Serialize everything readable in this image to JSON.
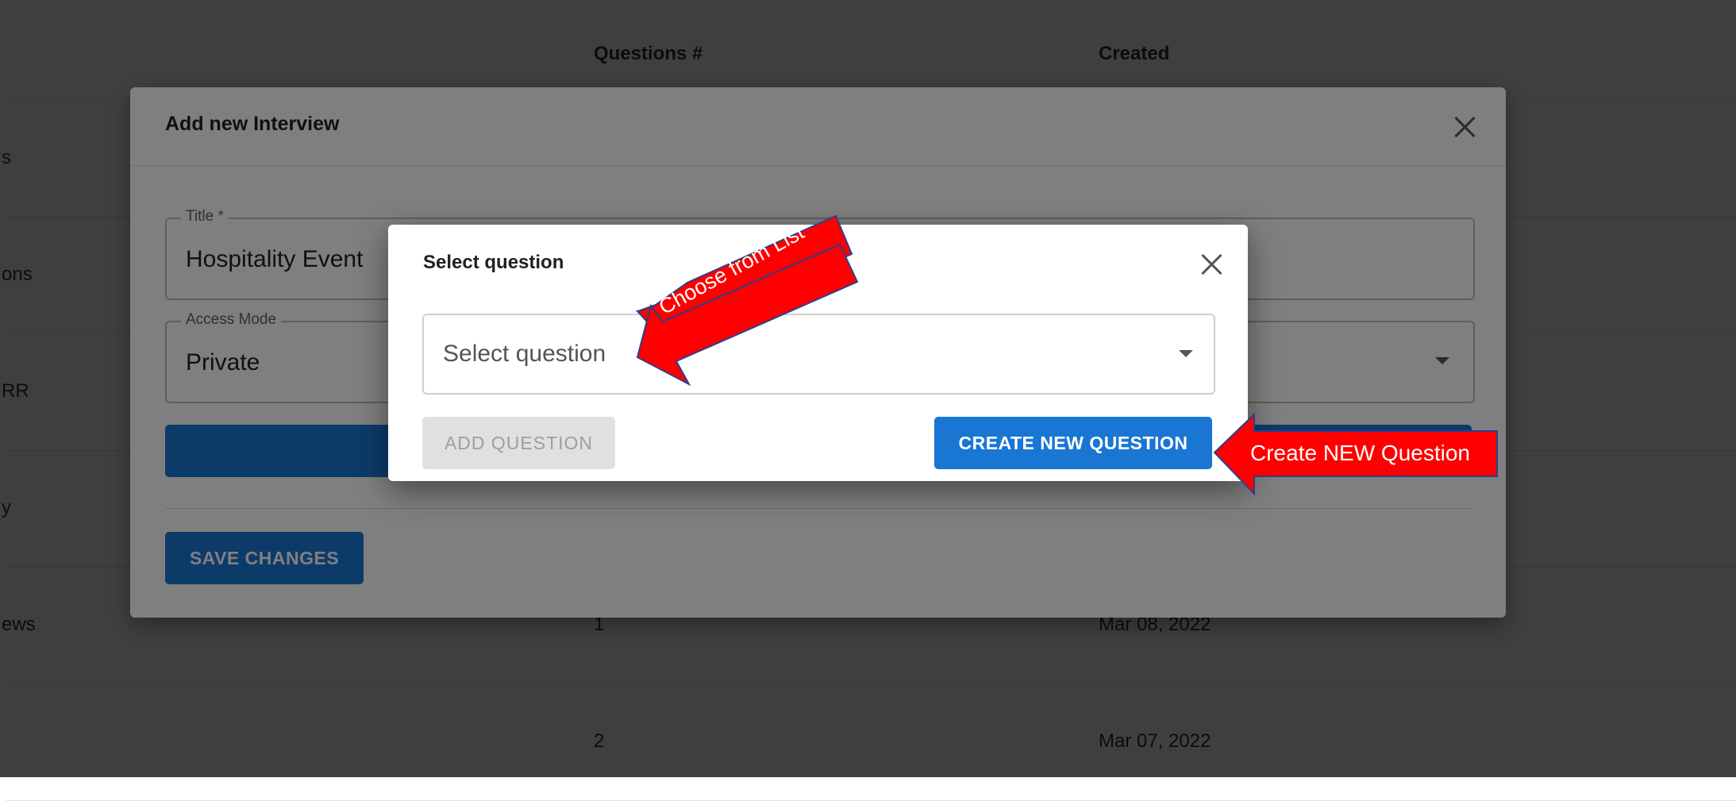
{
  "table": {
    "headers": {
      "questions": "Questions #",
      "created": "Created"
    },
    "rows": [
      {
        "name": "s",
        "questions": "",
        "created": ""
      },
      {
        "name": "ons",
        "questions": "",
        "created": ""
      },
      {
        "name": "RR",
        "questions": "",
        "created": ""
      },
      {
        "name": "y",
        "questions": "",
        "created": ""
      },
      {
        "name": "ews",
        "questions": "1",
        "created": "Mar 08, 2022"
      },
      {
        "name": "",
        "questions": "2",
        "created": "Mar 07, 2022"
      }
    ]
  },
  "interview_dialog": {
    "title": "Add new Interview",
    "title_field": {
      "label": "Title *",
      "value": "Hospitality Event"
    },
    "access_field": {
      "label": "Access Mode",
      "value": "Private"
    },
    "save_label": "SAVE CHANGES"
  },
  "select_dialog": {
    "title": "Select question",
    "placeholder": "Select question",
    "add_label": "ADD QUESTION",
    "create_label": "CREATE NEW QUESTION"
  },
  "annotations": {
    "choose": "Choose from List",
    "create": "Create NEW Question",
    "arrow_color": "#ff0000"
  },
  "colors": {
    "primary": "#1976d2",
    "disabled_bg": "#e0e0e0"
  }
}
